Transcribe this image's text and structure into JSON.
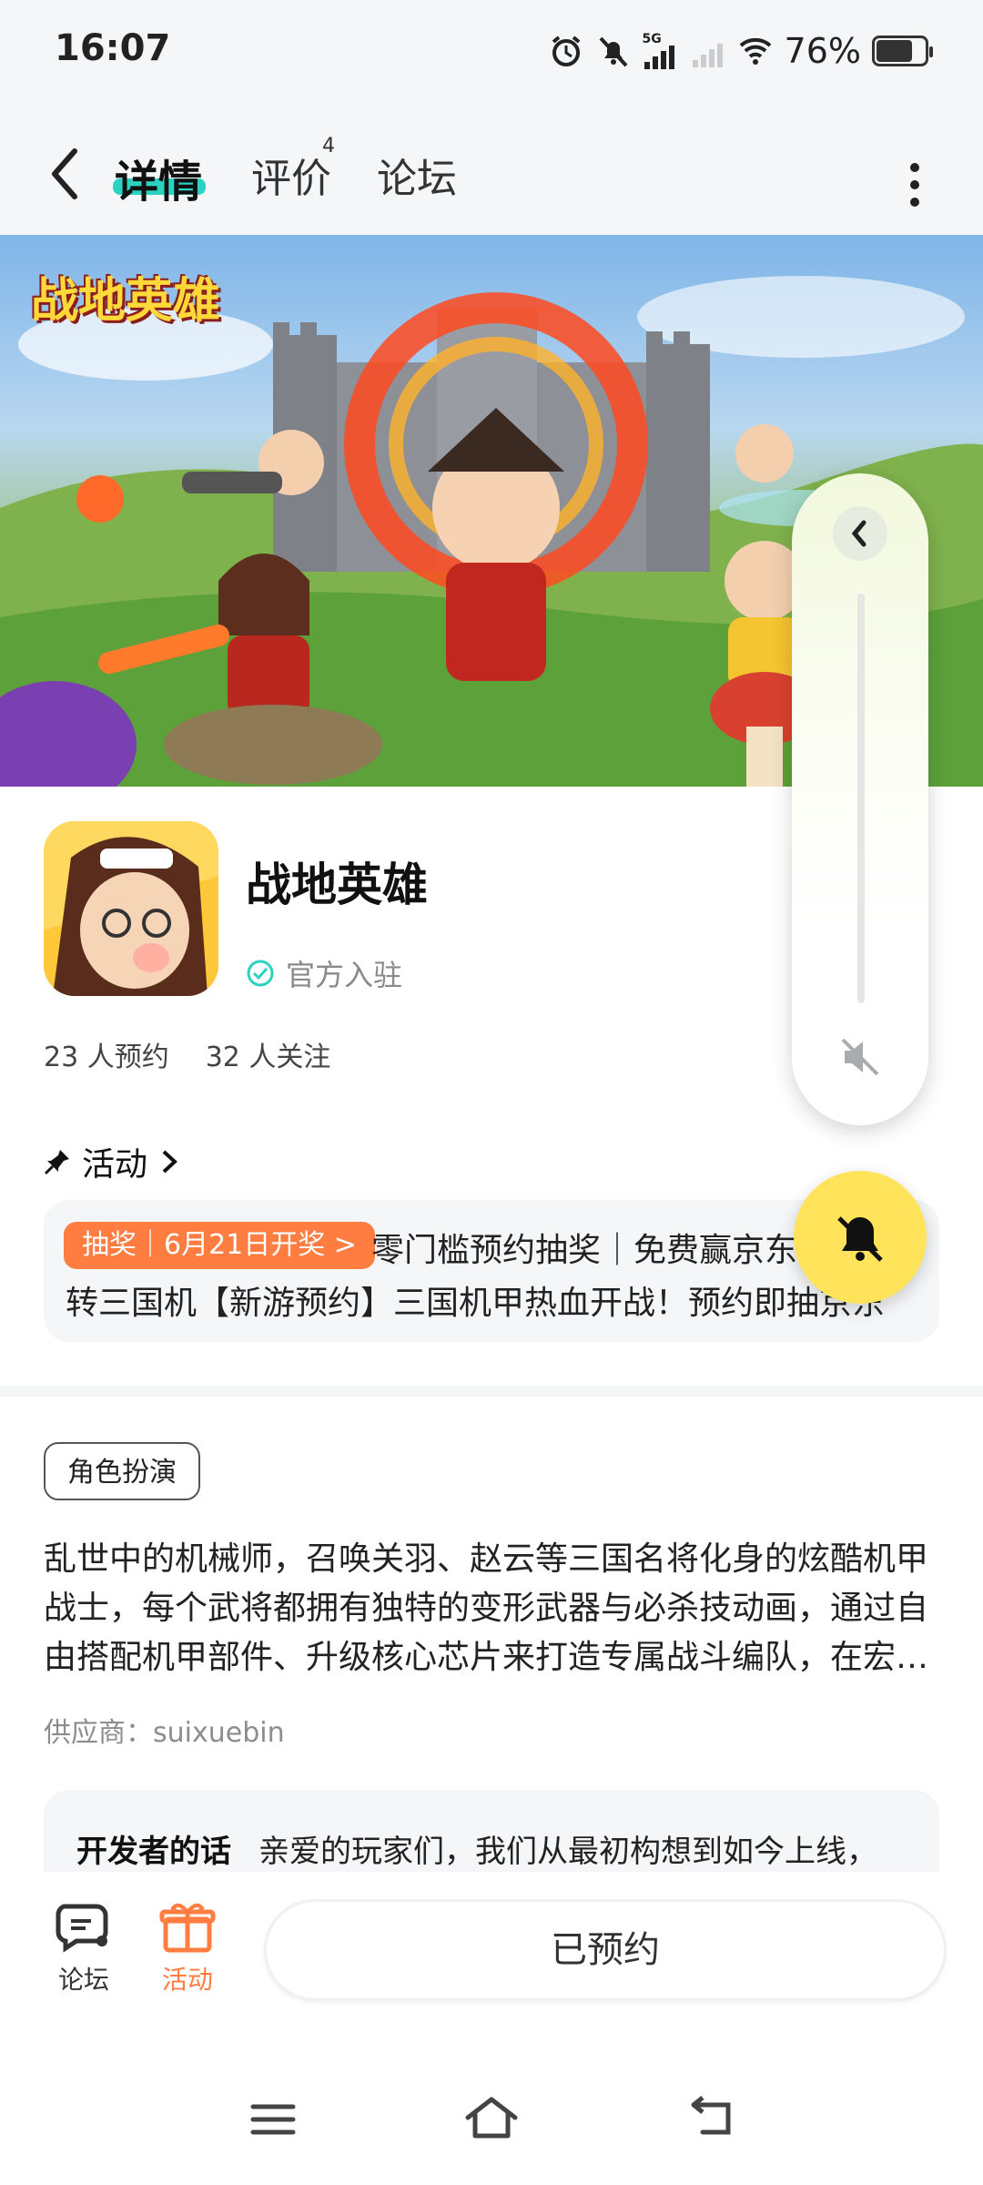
{
  "status_bar": {
    "time": "16:07",
    "signal_label": "5G",
    "battery": "76%"
  },
  "header": {
    "tabs": [
      {
        "label": "详情",
        "active": true
      },
      {
        "label": "评价",
        "count": "4"
      },
      {
        "label": "论坛"
      }
    ]
  },
  "banner": {
    "logo_text": "战地英雄"
  },
  "app": {
    "name": "战地英雄",
    "verified_label": "官方入驻",
    "reservations": "23 人预约",
    "followers": "32 人关注"
  },
  "activity": {
    "heading": "活动",
    "badge": "抽奖｜6月21日开奖 >",
    "line1": "零门槛预约抽奖｜免费赢京东",
    "line2": "转三国机【新游预约】三国机甲热血开战！预约即抽京东"
  },
  "genre_tag": "角色扮演",
  "description": "乱世中的机械师，召唤关羽、赵云等三国名将化身的炫酷机甲战士，每个武将都拥有独特的变形武器与必杀技动画，通过自由搭配机甲部件、升级核心芯片来打造专属战斗编队，在宏…",
  "supplier": "供应商：suixuebin",
  "developer": {
    "title": "开发者的话",
    "text": "亲爱的玩家们，我们从最初构想到如今上线，"
  },
  "bottom_bar": {
    "forum_label": "论坛",
    "activity_label": "活动",
    "reserved_label": "已预约"
  },
  "colors": {
    "accent_teal": "#2bd1c1",
    "accent_orange": "#ff7d40",
    "ring_yellow": "#ffe35a"
  },
  "volume_panel": {
    "level": 0
  }
}
